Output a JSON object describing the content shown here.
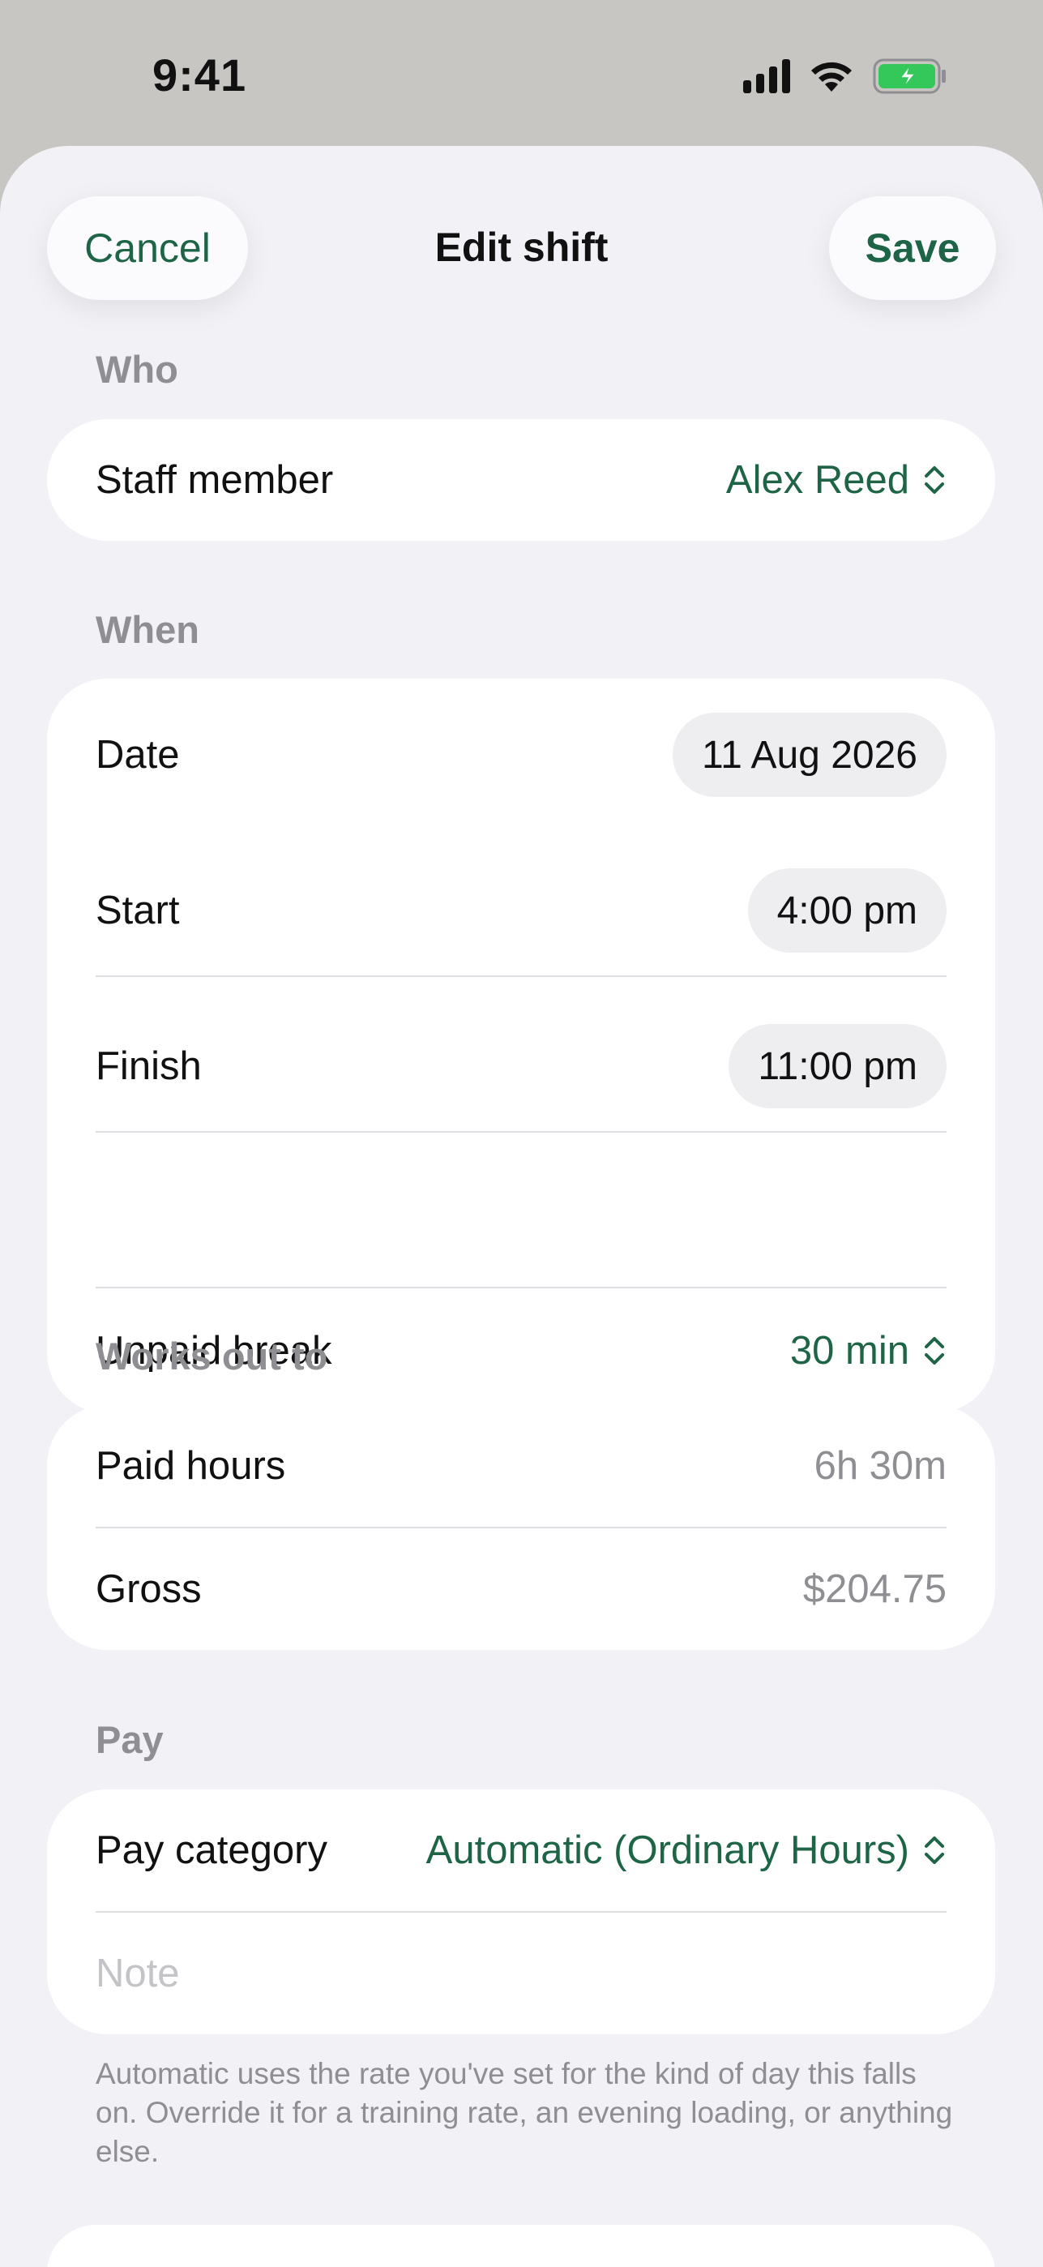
{
  "status_bar": {
    "time": "9:41"
  },
  "header": {
    "title": "Edit shift",
    "cancel_label": "Cancel",
    "save_label": "Save"
  },
  "who": {
    "section_label": "Who",
    "staff_member_label": "Staff member",
    "staff_member_value": "Alex Reed"
  },
  "when": {
    "section_label": "When",
    "date_label": "Date",
    "date_value": "11 Aug 2026",
    "start_label": "Start",
    "start_value": "4:00 pm",
    "finish_label": "Finish",
    "finish_value": "11:00 pm",
    "break_label": "Unpaid break",
    "break_value": "30 min"
  },
  "works_out": {
    "section_label": "Works out to",
    "paid_hours_label": "Paid hours",
    "paid_hours_value": "6h 30m",
    "gross_label": "Gross",
    "gross_value": "$204.75"
  },
  "pay": {
    "section_label": "Pay",
    "category_label": "Pay category",
    "category_value": "Automatic (Ordinary Hours)",
    "note_placeholder": "Note",
    "footnote": "Automatic uses the rate you've set for the kind of day this falls on. Override it for a training rate, an evening loading, or anything else."
  },
  "colors": {
    "accent": "#1e6446",
    "secondary_text": "#8e8e93",
    "sheet_bg": "#f1f1f6",
    "battery": "#34c759"
  },
  "icons": [
    "cellular-signal-icon",
    "wifi-icon",
    "battery-charging-icon",
    "chevron-up-down-icon"
  ]
}
